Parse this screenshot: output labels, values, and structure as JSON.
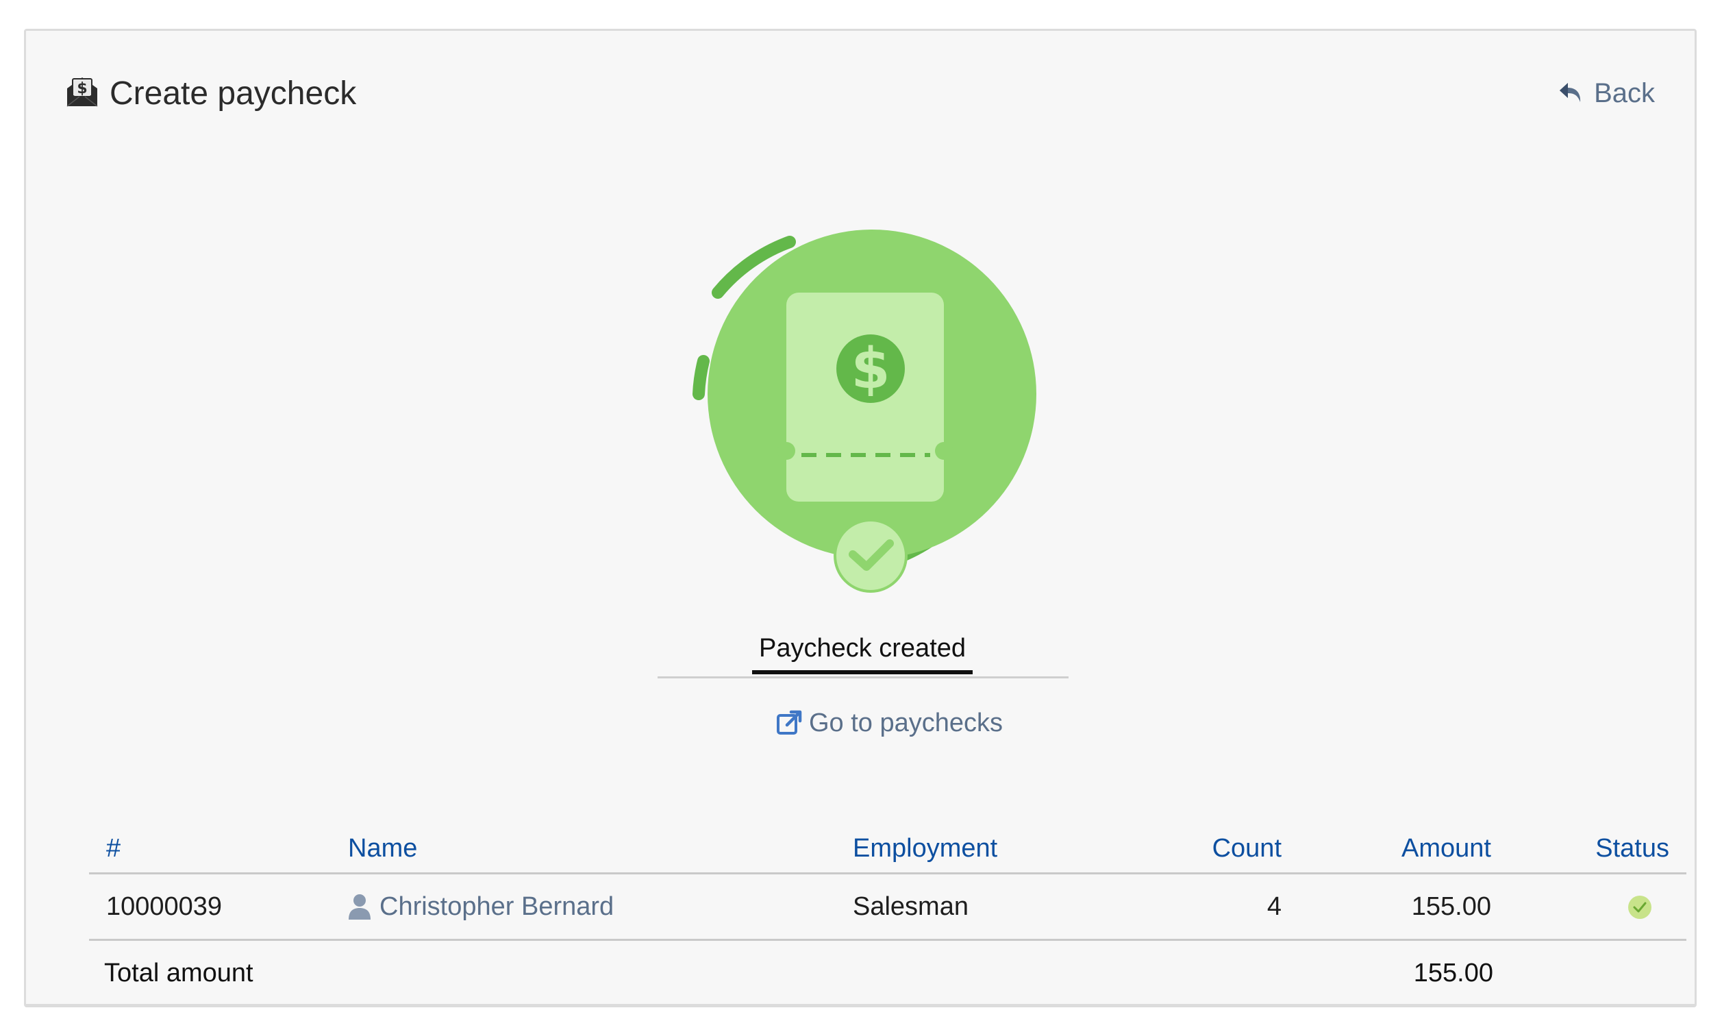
{
  "header": {
    "title": "Create paycheck",
    "back_label": "Back"
  },
  "result": {
    "tab_label": "Paycheck created",
    "link_label": "Go to paychecks"
  },
  "table": {
    "columns": [
      "#",
      "Name",
      "Employment",
      "Count",
      "Amount",
      "Status"
    ],
    "rows": [
      {
        "number": "10000039",
        "name": "Christopher Bernard",
        "employment": "Salesman",
        "count": "4",
        "amount": "155.00",
        "status": "success"
      }
    ],
    "footer": {
      "label": "Total amount",
      "amount": "155.00"
    }
  },
  "colors": {
    "accent_blue": "#0d4fa0",
    "link_slate": "#5a6f8a",
    "success_green": "#5fb548",
    "illustration_light_green": "#8fd56e",
    "illustration_pale_green": "#c3edaa"
  },
  "icons": {
    "title": "paycheck-envelope-icon",
    "back": "reply-arrow-icon",
    "goto": "external-link-icon",
    "person": "person-icon",
    "status": "check-circle-icon"
  }
}
